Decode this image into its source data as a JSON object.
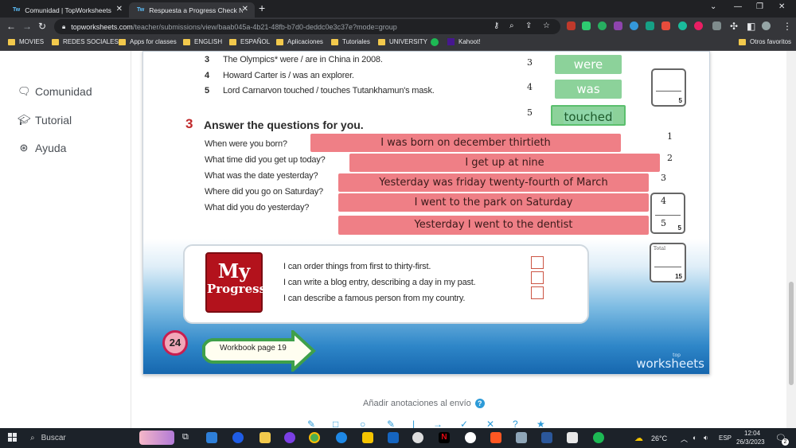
{
  "browser": {
    "tabs": [
      {
        "label": "Comunidad | TopWorksheets",
        "favicon": "Tw",
        "active": false
      },
      {
        "label": "Respuesta a Progress Check NM",
        "favicon": "Tw",
        "active": true
      }
    ],
    "url_host": "topworksheets.com",
    "url_path": "/teacher/submissions/view/baab045a-4b21-48fb-b7d0-deddc0e3c37e?mode=group",
    "bookmarks": [
      "MOVIES",
      "REDES SOCIALES",
      "Apps for classes",
      "ENGLISH",
      "ESPAÑOL",
      "Aplicaciones",
      "Tutoriales",
      "UNIVERSITY",
      "Kahoot!"
    ],
    "other_bookmarks": "Otros favoritos"
  },
  "sidebar": {
    "items": [
      {
        "label": "Comunidad",
        "icon": "chat-bubbles-icon"
      },
      {
        "label": "Tutorial",
        "icon": "graduation-cap-icon"
      },
      {
        "label": "Ayuda",
        "icon": "lifebuoy-icon"
      }
    ]
  },
  "worksheet": {
    "exercise2": {
      "lines": [
        {
          "num": "3",
          "text": "The Olympics* were / are in China in 2008."
        },
        {
          "num": "4",
          "text": "Howard Carter is / was an explorer."
        },
        {
          "num": "5",
          "text": "Lord Carnarvon touched / touches Tutankhamun's mask."
        }
      ],
      "answer_numbers": [
        "3",
        "4",
        "5"
      ],
      "answers": [
        "were",
        "was",
        "touched"
      ],
      "score_max": "5"
    },
    "exercise3": {
      "number": "3",
      "title": "Answer the questions for you.",
      "questions": [
        "When were you born?",
        "What time did you get up today?",
        "What was the date yesterday?",
        "Where did you go on Saturday?",
        "What did you do yesterday?"
      ],
      "answers": [
        "I was born on december thirtieth",
        "I get up at nine",
        "Yesterday was friday twenty-fourth of March",
        "I went to the park on Saturday",
        "Yesterday I went to the dentist"
      ],
      "answer_numbers": [
        "1",
        "2",
        "3",
        "4",
        "5"
      ],
      "score_value": "4",
      "score_max": "5"
    },
    "total": {
      "label": "Total",
      "max": "15"
    },
    "my_progress": {
      "logo_line1": "My",
      "logo_line2": "Progress",
      "statements": [
        "I can order things from first to thirty-first.",
        "I can write a blog entry, describing a day in my past.",
        "I can describe a famous person from my country."
      ]
    },
    "page_number": "24",
    "workbook_label": "Workbook page 19",
    "brand_small": "top",
    "brand": "worksheets"
  },
  "annotations_label": "Añadir anotaciones al envío",
  "taskbar": {
    "search_placeholder": "Buscar",
    "weather": "26°C",
    "language": "ESP",
    "time": "12:04",
    "date": "26/3/2023",
    "notifications": "2"
  },
  "colors": {
    "answer_green": "#8cd29a",
    "answer_pink": "#ef7f86",
    "accent": "#2d9bd8"
  }
}
